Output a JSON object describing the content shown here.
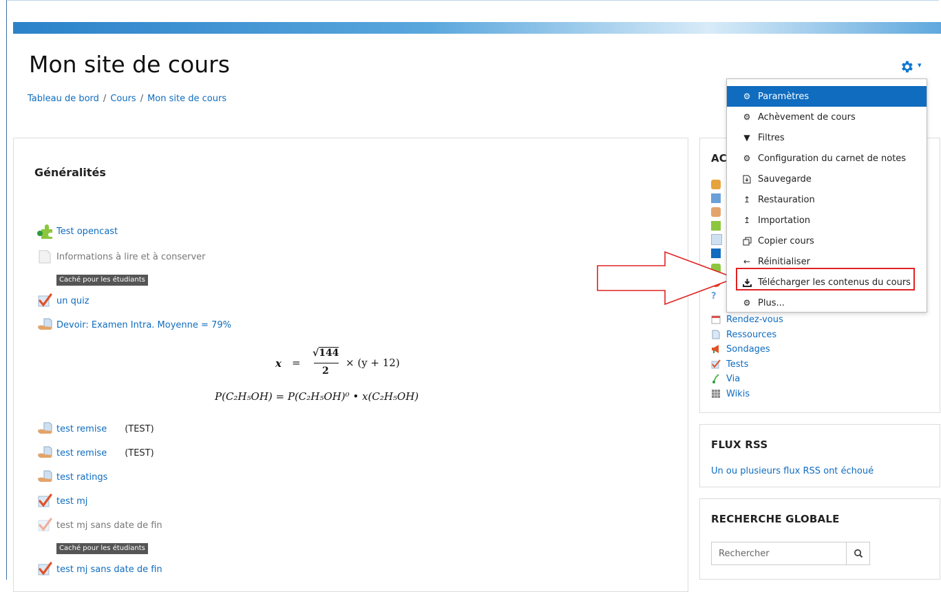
{
  "page": {
    "title": "Mon site de cours",
    "breadcrumb": [
      "Tableau de bord",
      "Cours",
      "Mon site de cours"
    ],
    "breadcrumb_sep": "/"
  },
  "main": {
    "section_title": "Généralités",
    "activities": [
      {
        "label": "Test opencast",
        "icon": "puzzle-icon"
      },
      {
        "label": "Informations à lire et à conserver",
        "icon": "page-icon"
      },
      {
        "label": "un quiz",
        "icon": "quiz-icon"
      },
      {
        "label": "Devoir: Examen Intra. Moyenne = 79%",
        "icon": "assignment-icon"
      },
      {
        "label": "test remise",
        "tag": "(TEST)",
        "icon": "assignment-icon"
      },
      {
        "label": "test remise",
        "tag": "(TEST)",
        "icon": "assignment-icon"
      },
      {
        "label": "test ratings",
        "icon": "assignment-icon"
      },
      {
        "label": "test mj",
        "icon": "quiz-icon"
      },
      {
        "label": "test mj sans date de fin",
        "icon": "quiz-icon"
      },
      {
        "label": "test mj sans date de fin",
        "icon": "quiz-icon"
      }
    ],
    "hidden_badge": "Caché pour les étudiants",
    "math": {
      "line1_lhs": "x",
      "line1_eq": "=",
      "line1_num": "144",
      "line1_den": "2",
      "line1_rest": "× (y + 12)",
      "line2": "P(C₂H₅OH) = P(C₂H₅OH)⁰ • x(C₂H₅OH)"
    }
  },
  "sidebar": {
    "activities_title_fragment": "AC",
    "activity_links": [
      "Rendez-vous",
      "Ressources",
      "Sondages",
      "Tests",
      "Via",
      "Wikis"
    ],
    "rss": {
      "title": "FLUX RSS",
      "message": "Un ou plusieurs flux RSS ont échoué"
    },
    "search": {
      "title": "RECHERCHE GLOBALE",
      "placeholder": "Rechercher"
    }
  },
  "menu": {
    "items": [
      {
        "label": "Paramètres",
        "icon": "gear-icon",
        "active": true
      },
      {
        "label": "Achèvement de cours",
        "icon": "gear-icon"
      },
      {
        "label": "Filtres",
        "icon": "filter-icon"
      },
      {
        "label": "Configuration du carnet de notes",
        "icon": "gear-icon"
      },
      {
        "label": "Sauvegarde",
        "icon": "backup-icon"
      },
      {
        "label": "Restauration",
        "icon": "upload-icon"
      },
      {
        "label": "Importation",
        "icon": "upload-icon"
      },
      {
        "label": "Copier cours",
        "icon": "copy-icon"
      },
      {
        "label": "Réinitialiser",
        "icon": "arrow-left-icon"
      },
      {
        "label": "Télécharger les contenus du cours",
        "icon": "download-icon"
      },
      {
        "label": "Plus...",
        "icon": "gear-icon"
      }
    ]
  },
  "colors": {
    "link": "#0f6cbf",
    "active_bg": "#0f6cbf",
    "highlight": "#e02020",
    "arrow": "#e02020"
  }
}
